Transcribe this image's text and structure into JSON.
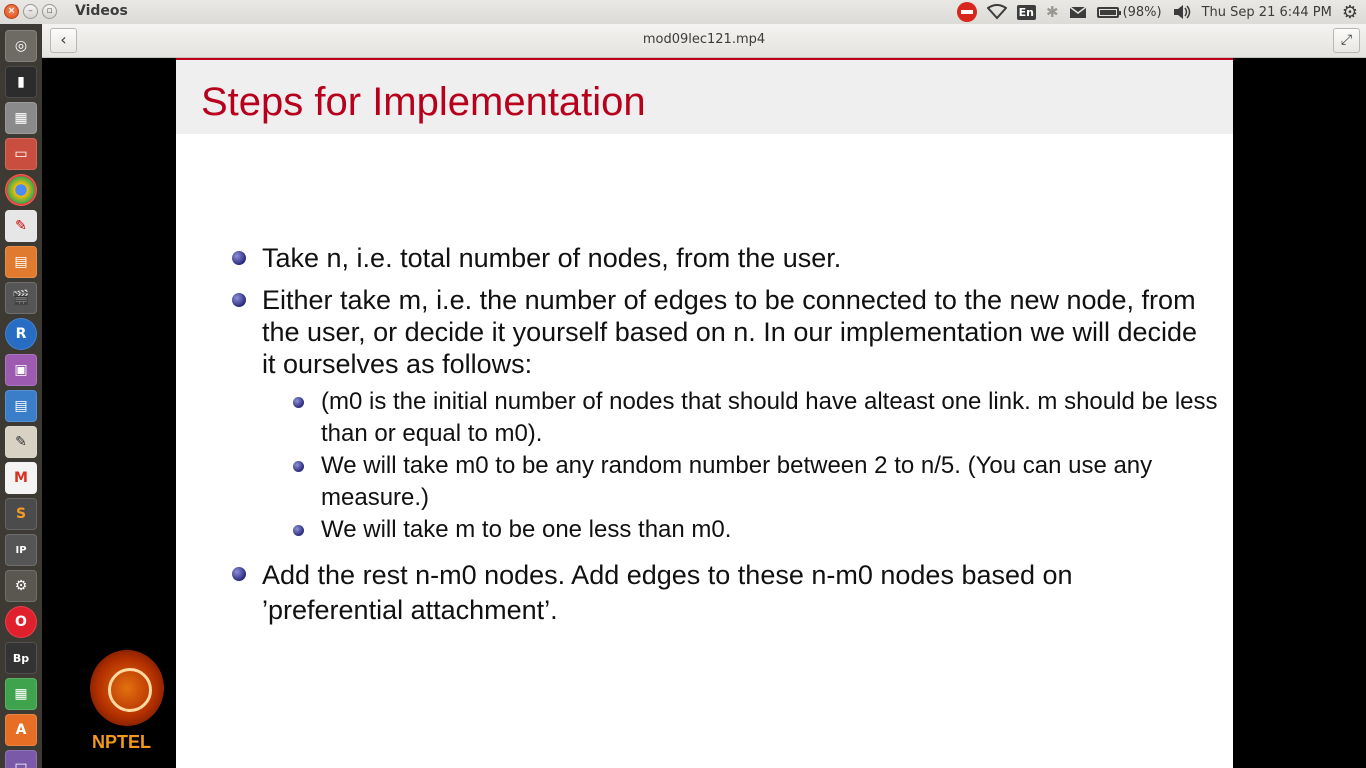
{
  "window": {
    "app_title": "Videos"
  },
  "indicators": {
    "keyboard": "En",
    "battery": "(98%)",
    "datetime": "Thu Sep 21  6:44 PM"
  },
  "header": {
    "file_title": "mod09lec121.mp4"
  },
  "slide": {
    "title": "Steps for Implementation",
    "bullets": [
      "Take n, i.e. total number of nodes, from the user.",
      "Either take m, i.e. the number of edges to be connected to the new node, from the user, or decide it yourself based on n. In our implementation we will decide it ourselves as follows:",
      "Add the rest n-m0 nodes. Add edges to these n-m0 nodes based on ’preferential attachment’."
    ],
    "sub_bullets": [
      "(m0 is the initial number of nodes that should have alteast one link. m should be less than or equal to m0).",
      "We will take m0 to be any random number between 2 to n/5. (You can use any measure.)",
      "We will take m to be one less than m0."
    ]
  },
  "logo": {
    "text": "NPTEL"
  },
  "launcher": {
    "icons": [
      "ubuntu-dash-icon",
      "terminal-icon",
      "calculator-icon",
      "files-icon",
      "chrome-icon",
      "pdf-viewer-icon",
      "impress-icon",
      "video-editor-icon",
      "r-icon",
      "screenshot-icon",
      "writer-icon",
      "text-editor-icon",
      "gmail-icon",
      "sublime-icon",
      "ipython-icon",
      "settings-icon",
      "opera-icon",
      "photo-icon",
      "spreadsheet-icon",
      "software-center-icon",
      "drive-icon"
    ]
  }
}
